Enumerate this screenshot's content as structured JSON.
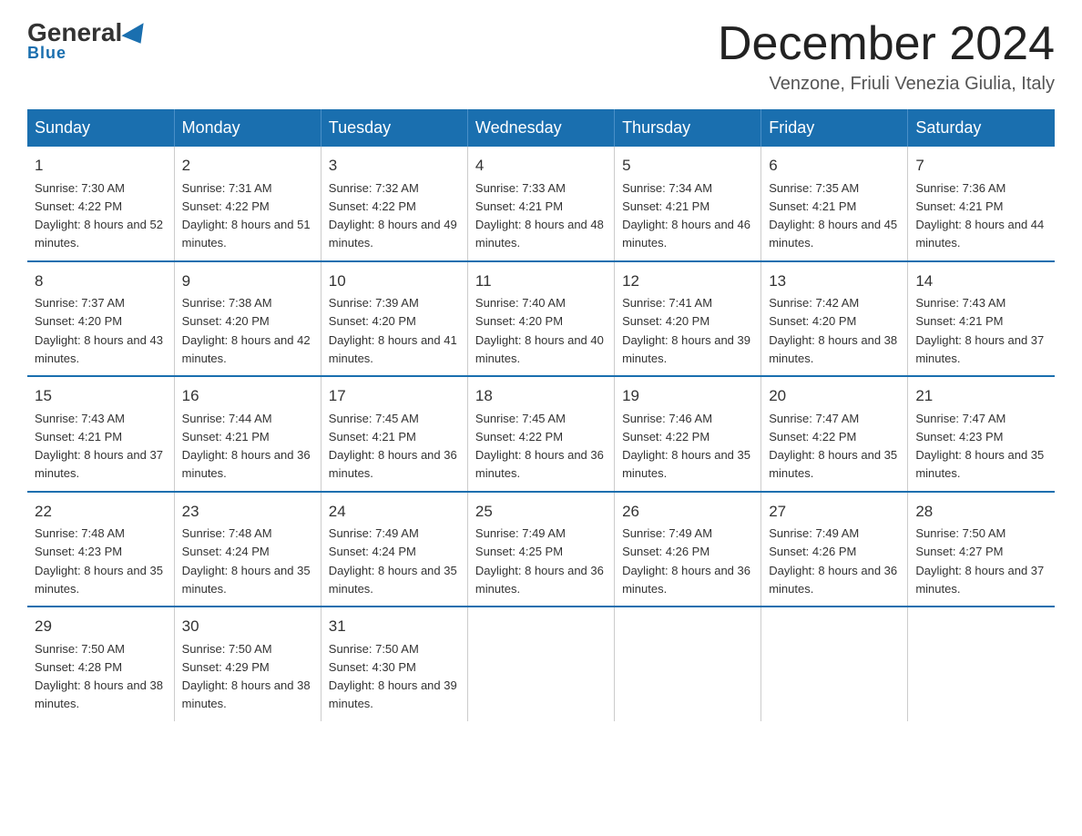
{
  "header": {
    "logo_general": "General",
    "logo_blue": "Blue",
    "title": "December 2024",
    "location": "Venzone, Friuli Venezia Giulia, Italy"
  },
  "weekdays": [
    "Sunday",
    "Monday",
    "Tuesday",
    "Wednesday",
    "Thursday",
    "Friday",
    "Saturday"
  ],
  "weeks": [
    [
      {
        "day": "1",
        "sunrise": "7:30 AM",
        "sunset": "4:22 PM",
        "daylight": "8 hours and 52 minutes."
      },
      {
        "day": "2",
        "sunrise": "7:31 AM",
        "sunset": "4:22 PM",
        "daylight": "8 hours and 51 minutes."
      },
      {
        "day": "3",
        "sunrise": "7:32 AM",
        "sunset": "4:22 PM",
        "daylight": "8 hours and 49 minutes."
      },
      {
        "day": "4",
        "sunrise": "7:33 AM",
        "sunset": "4:21 PM",
        "daylight": "8 hours and 48 minutes."
      },
      {
        "day": "5",
        "sunrise": "7:34 AM",
        "sunset": "4:21 PM",
        "daylight": "8 hours and 46 minutes."
      },
      {
        "day": "6",
        "sunrise": "7:35 AM",
        "sunset": "4:21 PM",
        "daylight": "8 hours and 45 minutes."
      },
      {
        "day": "7",
        "sunrise": "7:36 AM",
        "sunset": "4:21 PM",
        "daylight": "8 hours and 44 minutes."
      }
    ],
    [
      {
        "day": "8",
        "sunrise": "7:37 AM",
        "sunset": "4:20 PM",
        "daylight": "8 hours and 43 minutes."
      },
      {
        "day": "9",
        "sunrise": "7:38 AM",
        "sunset": "4:20 PM",
        "daylight": "8 hours and 42 minutes."
      },
      {
        "day": "10",
        "sunrise": "7:39 AM",
        "sunset": "4:20 PM",
        "daylight": "8 hours and 41 minutes."
      },
      {
        "day": "11",
        "sunrise": "7:40 AM",
        "sunset": "4:20 PM",
        "daylight": "8 hours and 40 minutes."
      },
      {
        "day": "12",
        "sunrise": "7:41 AM",
        "sunset": "4:20 PM",
        "daylight": "8 hours and 39 minutes."
      },
      {
        "day": "13",
        "sunrise": "7:42 AM",
        "sunset": "4:20 PM",
        "daylight": "8 hours and 38 minutes."
      },
      {
        "day": "14",
        "sunrise": "7:43 AM",
        "sunset": "4:21 PM",
        "daylight": "8 hours and 37 minutes."
      }
    ],
    [
      {
        "day": "15",
        "sunrise": "7:43 AM",
        "sunset": "4:21 PM",
        "daylight": "8 hours and 37 minutes."
      },
      {
        "day": "16",
        "sunrise": "7:44 AM",
        "sunset": "4:21 PM",
        "daylight": "8 hours and 36 minutes."
      },
      {
        "day": "17",
        "sunrise": "7:45 AM",
        "sunset": "4:21 PM",
        "daylight": "8 hours and 36 minutes."
      },
      {
        "day": "18",
        "sunrise": "7:45 AM",
        "sunset": "4:22 PM",
        "daylight": "8 hours and 36 minutes."
      },
      {
        "day": "19",
        "sunrise": "7:46 AM",
        "sunset": "4:22 PM",
        "daylight": "8 hours and 35 minutes."
      },
      {
        "day": "20",
        "sunrise": "7:47 AM",
        "sunset": "4:22 PM",
        "daylight": "8 hours and 35 minutes."
      },
      {
        "day": "21",
        "sunrise": "7:47 AM",
        "sunset": "4:23 PM",
        "daylight": "8 hours and 35 minutes."
      }
    ],
    [
      {
        "day": "22",
        "sunrise": "7:48 AM",
        "sunset": "4:23 PM",
        "daylight": "8 hours and 35 minutes."
      },
      {
        "day": "23",
        "sunrise": "7:48 AM",
        "sunset": "4:24 PM",
        "daylight": "8 hours and 35 minutes."
      },
      {
        "day": "24",
        "sunrise": "7:49 AM",
        "sunset": "4:24 PM",
        "daylight": "8 hours and 35 minutes."
      },
      {
        "day": "25",
        "sunrise": "7:49 AM",
        "sunset": "4:25 PM",
        "daylight": "8 hours and 36 minutes."
      },
      {
        "day": "26",
        "sunrise": "7:49 AM",
        "sunset": "4:26 PM",
        "daylight": "8 hours and 36 minutes."
      },
      {
        "day": "27",
        "sunrise": "7:49 AM",
        "sunset": "4:26 PM",
        "daylight": "8 hours and 36 minutes."
      },
      {
        "day": "28",
        "sunrise": "7:50 AM",
        "sunset": "4:27 PM",
        "daylight": "8 hours and 37 minutes."
      }
    ],
    [
      {
        "day": "29",
        "sunrise": "7:50 AM",
        "sunset": "4:28 PM",
        "daylight": "8 hours and 38 minutes."
      },
      {
        "day": "30",
        "sunrise": "7:50 AM",
        "sunset": "4:29 PM",
        "daylight": "8 hours and 38 minutes."
      },
      {
        "day": "31",
        "sunrise": "7:50 AM",
        "sunset": "4:30 PM",
        "daylight": "8 hours and 39 minutes."
      },
      null,
      null,
      null,
      null
    ]
  ]
}
